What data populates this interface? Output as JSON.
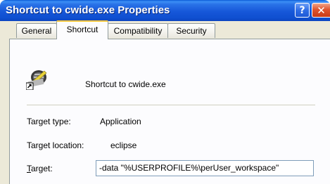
{
  "window": {
    "title": "Shortcut to cwide.exe Properties",
    "help_glyph": "?",
    "close_glyph": "✕"
  },
  "tabs": [
    {
      "label": "General",
      "active": false
    },
    {
      "label": "Shortcut",
      "active": true
    },
    {
      "label": "Compatibility",
      "active": false
    },
    {
      "label": "Security",
      "active": false
    }
  ],
  "shortcut": {
    "name": "Shortcut to cwide.exe",
    "icon": "eclipse-app-icon"
  },
  "fields": {
    "target_type_label": "Target type:",
    "target_type_value": "Application",
    "target_location_label": "Target location:",
    "target_location_value": "eclipse",
    "target_label_first": "T",
    "target_label_rest": "arget:",
    "target_value": "-data \"%USERPROFILE%\\perUser_workspace\""
  },
  "colors": {
    "titlebar": "#0f4fd0",
    "active_tab_accent": "#ffc83c",
    "dialog_bg": "#ece9d8"
  }
}
